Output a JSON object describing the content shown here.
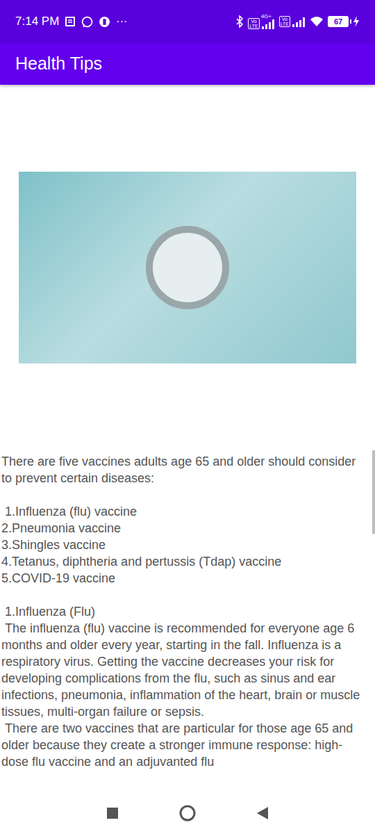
{
  "status_bar": {
    "time": "7:14 PM",
    "more": "···",
    "sims": [
      {
        "badge_top": "Vo",
        "badge_bottom": "LTE",
        "network": "4G+"
      },
      {
        "badge_top": "Vo",
        "badge_bottom": "LTE"
      }
    ],
    "battery": "67",
    "charging": true
  },
  "app_bar": {
    "title": "Health Tips"
  },
  "content": {
    "intro": "There are five vaccines adults age 65 and older should consider to prevent certain diseases:",
    "list": [
      " 1.Influenza (flu) vaccine",
      "2.Pneumonia vaccine",
      "3.Shingles vaccine",
      "4.Tetanus, diphtheria and pertussis (Tdap) vaccine",
      "5.COVID-19 vaccine"
    ],
    "section_title": " 1.Influenza (Flu)",
    "paragraphs": [
      " The influenza (flu) vaccine is recommended for everyone age 6 months and older every year, starting in the fall. Influenza is a respiratory virus. Getting the vaccine decreases your risk for developing complications from the flu, such as sinus and ear infections, pneumonia, inflammation of the heart, brain or muscle tissues, multi-organ failure or sepsis.",
      " There are two vaccines that are particular for those age 65 and older because they create a stronger immune response: high-dose flu vaccine and an adjuvanted flu"
    ]
  }
}
